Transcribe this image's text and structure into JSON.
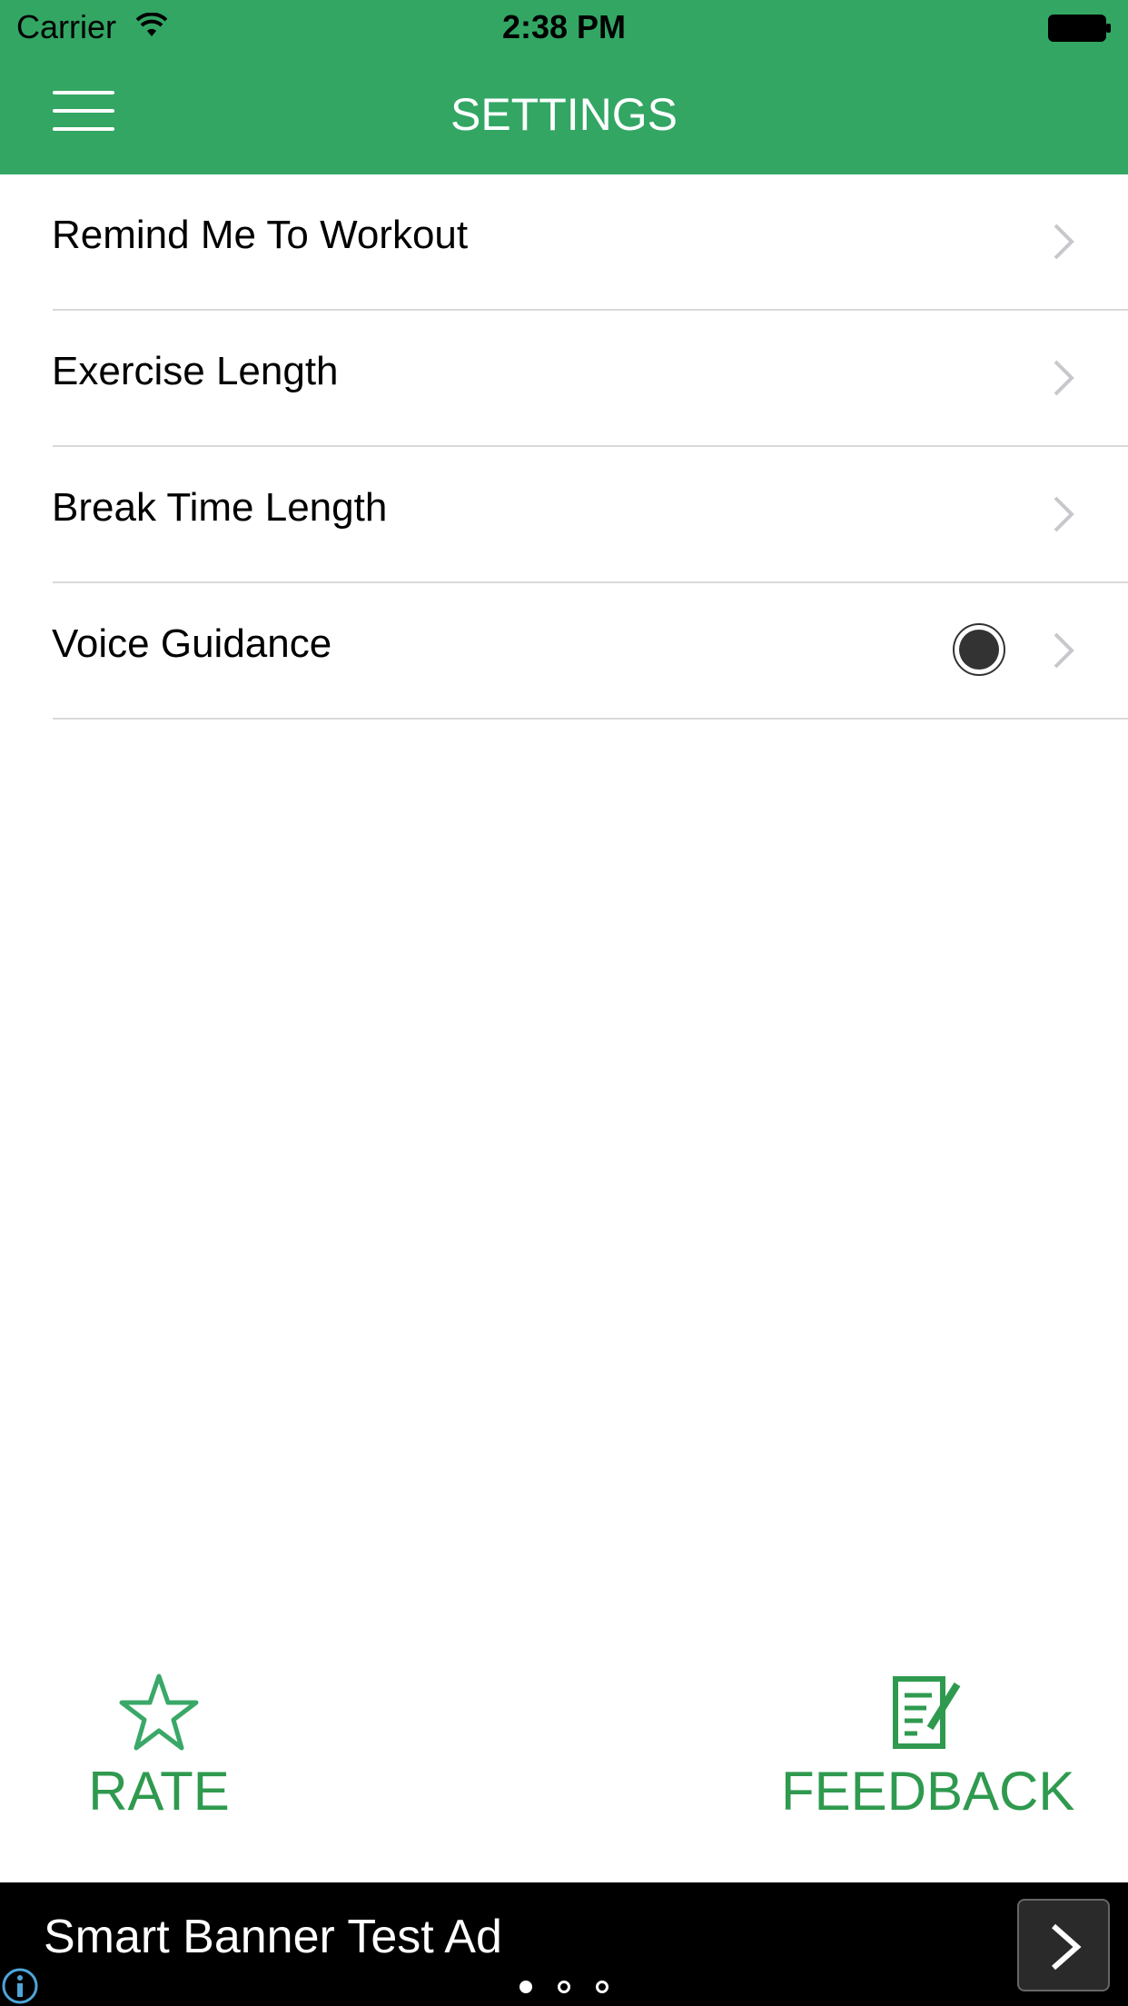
{
  "status_bar": {
    "carrier": "Carrier",
    "time": "2:38 PM",
    "wifi_icon": "wifi-icon",
    "battery_icon": "battery-icon"
  },
  "header": {
    "title": "SETTINGS",
    "menu_icon": "hamburger-menu-icon",
    "background_color": "#33a664"
  },
  "settings": {
    "items": [
      {
        "label": "Remind Me To Workout"
      },
      {
        "label": "Exercise Length"
      },
      {
        "label": "Break Time Length"
      },
      {
        "label": "Voice Guidance",
        "radio_selected": true
      }
    ]
  },
  "actions": {
    "rate": {
      "label": "RATE",
      "icon": "star-icon"
    },
    "feedback": {
      "label": "FEEDBACK",
      "icon": "feedback-note-icon"
    },
    "color": "#2f9a4f"
  },
  "ad": {
    "text": "Smart Banner Test Ad",
    "arrow_icon": "chevron-right-icon",
    "info_icon": "info-icon",
    "pages": 3,
    "active_page": 1
  }
}
